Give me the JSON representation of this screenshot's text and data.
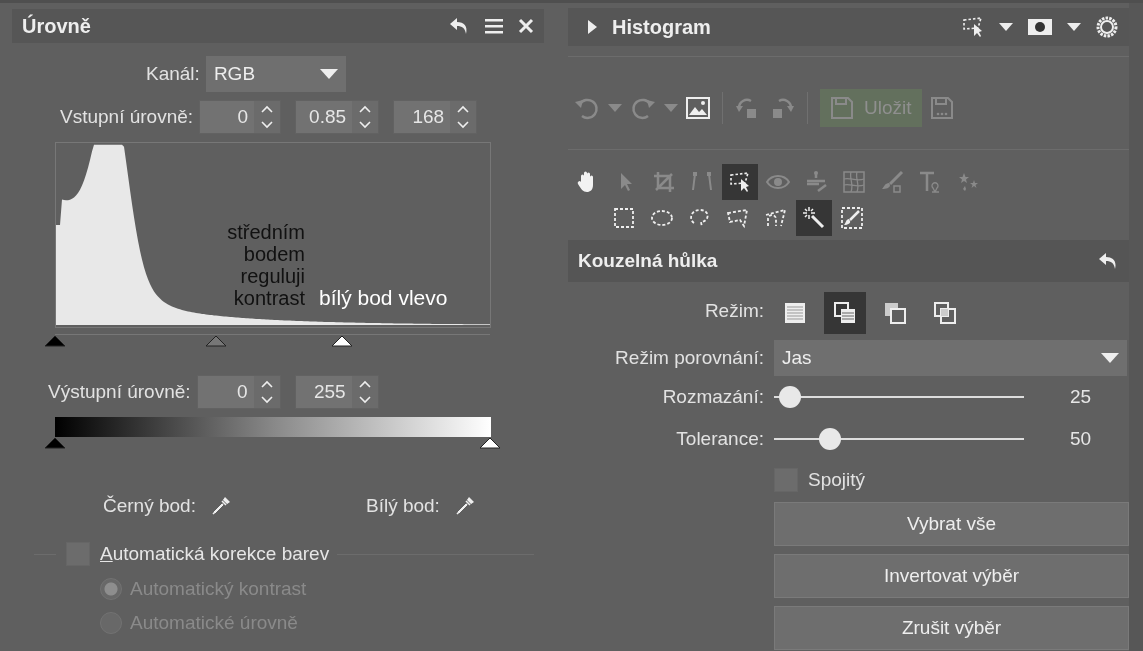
{
  "levels_panel": {
    "title": "Úrovně",
    "channel": {
      "label": "Kanál:",
      "value": "RGB"
    },
    "input_levels": {
      "label": "Vstupní úrovně:",
      "fields": [
        "0",
        "0.85",
        "168"
      ]
    },
    "histogram": {
      "annotations": [
        "středním bodem reguluji kontrast",
        "bílý bod vlevo"
      ],
      "markers": [
        {
          "kind": "black",
          "level": 0
        },
        {
          "kind": "gray",
          "level": 0.37
        },
        {
          "kind": "white",
          "level": 0.66
        }
      ]
    },
    "output_levels": {
      "label": "Výstupní úrovně:",
      "fields": [
        "0",
        "255"
      ],
      "markers": [
        {
          "kind": "black",
          "level": 0
        },
        {
          "kind": "white",
          "level": 1
        }
      ]
    },
    "black_point": {
      "label": "Černý bod:"
    },
    "white_point": {
      "label": "Bílý bod:"
    },
    "auto_color": {
      "label": "Automatická korekce barev",
      "checked": false,
      "options": [
        {
          "label": "Automatický kontrast",
          "selected": true,
          "disabled": true
        },
        {
          "label": "Automatické úrovně",
          "selected": false,
          "disabled": true
        }
      ]
    }
  },
  "histogram_panel": {
    "title": "Histogram",
    "expanded": false
  },
  "toolbar": {
    "save_button": {
      "label": "Uložit",
      "disabled": true
    }
  },
  "tools": [
    {
      "selected": false
    },
    {
      "selected": false
    },
    {
      "selected": false
    },
    {
      "selected": false
    },
    {
      "selected": true
    },
    {
      "selected": false
    },
    {
      "selected": false
    },
    {
      "selected": false
    },
    {
      "selected": false
    },
    {
      "selected": false
    },
    {
      "selected": false
    }
  ],
  "selection_tools": [
    {
      "selected": false
    },
    {
      "selected": false
    },
    {
      "selected": false
    },
    {
      "selected": false
    },
    {
      "selected": false
    },
    {
      "selected": true
    },
    {
      "selected": false
    }
  ],
  "magic_wand": {
    "title": "Kouzelná hůlka",
    "mode": {
      "label": "Režim:",
      "options": [
        {
          "selected": false
        },
        {
          "selected": true
        },
        {
          "selected": false
        },
        {
          "selected": false
        }
      ]
    },
    "compare_mode": {
      "label": "Režim porovnání:",
      "value": "Jas"
    },
    "sliders": [
      {
        "label": "Rozmazání:",
        "level": 0.065,
        "reading": "25"
      },
      {
        "label": "Tolerance:",
        "level": 0.225,
        "reading": "50"
      }
    ],
    "contiguous": {
      "label": "Spojitý",
      "checked": false
    },
    "buttons": [
      "Vybrat vše",
      "Invertovat výběr",
      "Zrušit výběr"
    ]
  }
}
